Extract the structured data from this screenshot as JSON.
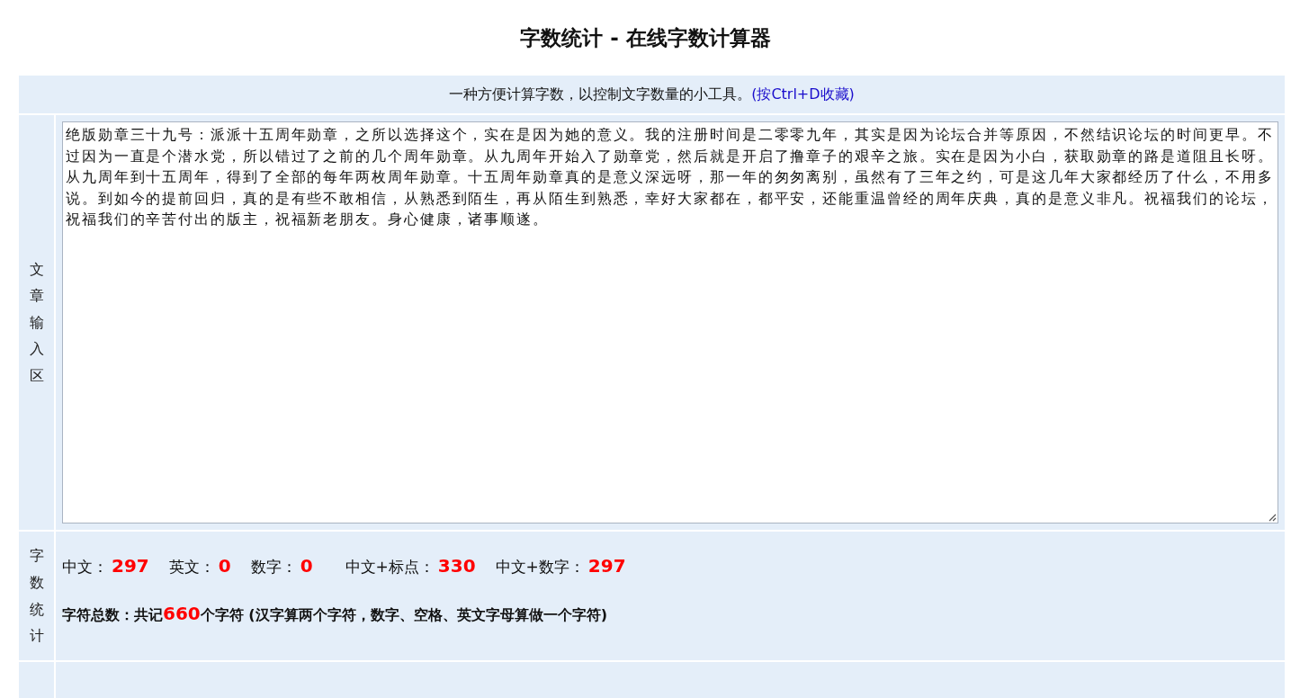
{
  "page_title": "字数统计 - 在线字数计算器",
  "intro": {
    "text": "一种方便计算字数，以控制文字数量的小工具。",
    "link": "(按Ctrl+D收藏)"
  },
  "input_section": {
    "label": "文章输入区",
    "value": "绝版勋章三十九号：派派十五周年勋章，之所以选择这个，实在是因为她的意义。我的注册时间是二零零九年，其实是因为论坛合并等原因，不然结识论坛的时间更早。不过因为一直是个潜水党，所以错过了之前的几个周年勋章。从九周年开始入了勋章党，然后就是开启了撸章子的艰辛之旅。实在是因为小白，获取勋章的路是道阻且长呀。从九周年到十五周年，得到了全部的每年两枚周年勋章。十五周年勋章真的是意义深远呀，那一年的匆匆离别，虽然有了三年之约，可是这几年大家都经历了什么，不用多说。到如今的提前回归，真的是有些不敢相信，从熟悉到陌生，再从陌生到熟悉，幸好大家都在，都平安，还能重温曾经的周年庆典，真的是意义非凡。祝福我们的论坛，祝福我们的辛苦付出的版主，祝福新老朋友。身心健康，诸事顺遂。"
  },
  "stats_section": {
    "label": "字数统计",
    "counts": [
      {
        "label": "中文：",
        "value": "297"
      },
      {
        "label": "英文：",
        "value": "0"
      },
      {
        "label": "数字：",
        "value": "0"
      },
      {
        "label": "中文+标点：",
        "value": "330"
      },
      {
        "label": "中文+数字：",
        "value": "297"
      }
    ],
    "total": {
      "prefix": "字符总数：共记",
      "value": "660",
      "suffix": "个字符 (汉字算两个字符，数字、空格、英文字母算做一个字符)"
    }
  }
}
